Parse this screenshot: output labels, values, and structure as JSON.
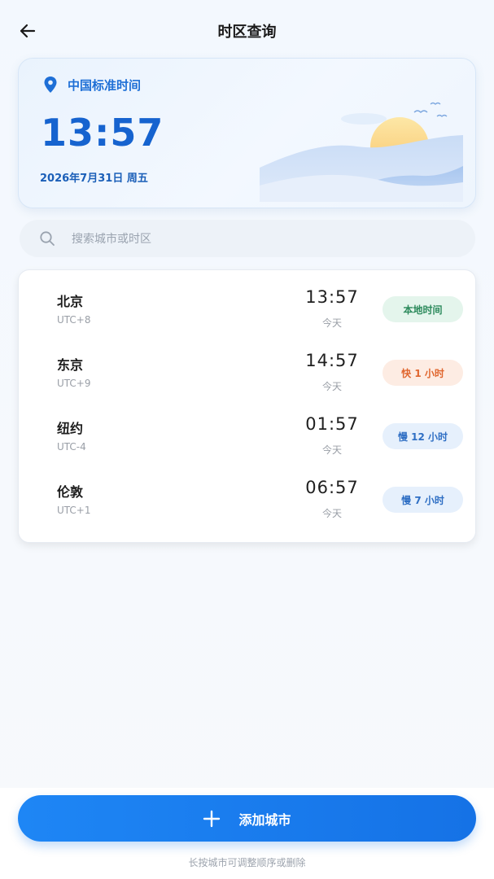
{
  "header": {
    "title": "时区查询",
    "back_icon": "arrow-left-icon"
  },
  "hero": {
    "location_icon": "map-pin-icon",
    "location_label": "中国标准时间",
    "time": "13:57",
    "date": "2026年7月31日  周五",
    "illustration": "sun-mountains-birds"
  },
  "search": {
    "icon": "search-icon",
    "placeholder": "搜索城市或时区"
  },
  "cities": [
    {
      "name": "北京",
      "offset": "UTC+8",
      "time": "13:57",
      "day": "今天",
      "badge": "本地时间",
      "badge_tone": "green"
    },
    {
      "name": "东京",
      "offset": "UTC+9",
      "time": "14:57",
      "day": "今天",
      "badge": "快 1 小时",
      "badge_tone": "orange"
    },
    {
      "name": "纽约",
      "offset": "UTC-4",
      "time": "01:57",
      "day": "今天",
      "badge": "慢 12 小时",
      "badge_tone": "blue"
    },
    {
      "name": "伦敦",
      "offset": "UTC+1",
      "time": "06:57",
      "day": "今天",
      "badge": "慢 7 小时",
      "badge_tone": "blue"
    }
  ],
  "footer": {
    "add_icon": "plus-icon",
    "add_label": "添加城市",
    "hint": "长按城市可调整顺序或删除"
  },
  "colors": {
    "accent": "#1572e6",
    "hero_time": "#1663cf",
    "badge_green": "#2c8a5c",
    "badge_orange": "#e0662e",
    "badge_blue": "#2f6fc4"
  }
}
